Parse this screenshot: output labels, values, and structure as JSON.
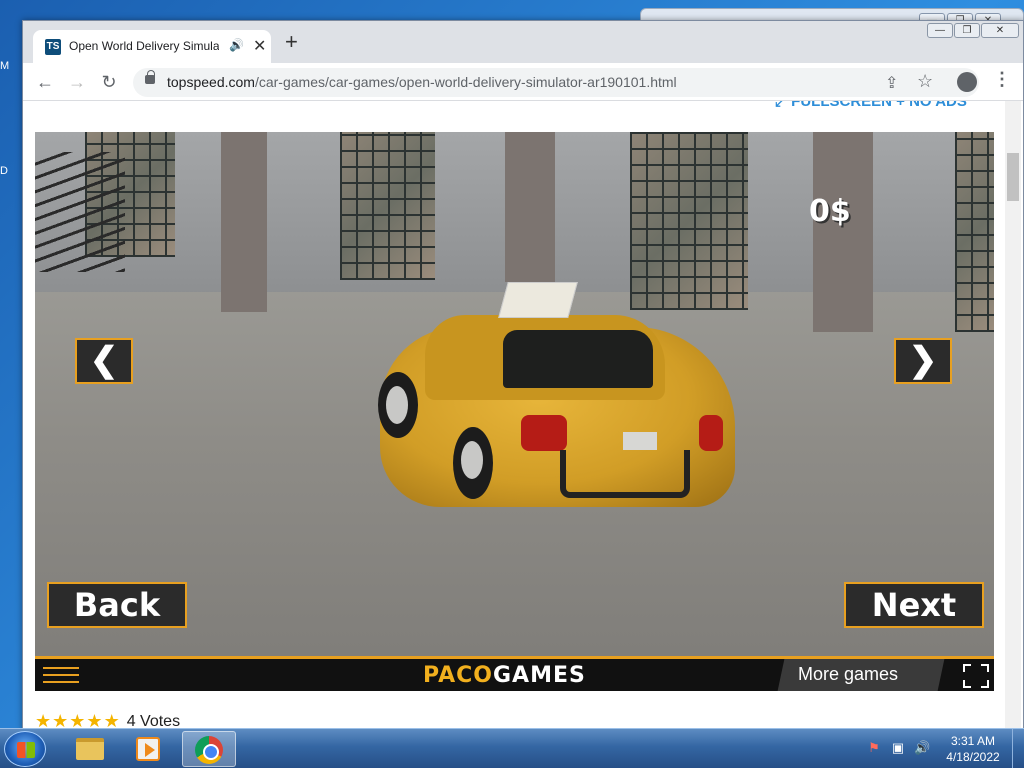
{
  "desktop": {
    "fragments": [
      "M",
      "D"
    ]
  },
  "browser": {
    "tab": {
      "favicon_text": "TS",
      "title": "Open World Delivery Simulator",
      "audio_icon": "speaker-icon",
      "close": "✕"
    },
    "new_tab": "+",
    "window_controls": {
      "minimize": "—",
      "maximize": "❐",
      "close": "✕"
    },
    "nav": {
      "back": "←",
      "forward": "→",
      "reload": "↻"
    },
    "url": {
      "host": "topspeed.com",
      "path": "/car-games/car-games/open-world-delivery-simulator-ar190101.html"
    },
    "omnibox_icons": {
      "share": "⇪",
      "star": "☆"
    },
    "menu": "⋮"
  },
  "page": {
    "fullscreen_link": "FULLSCREEN + NO ADS",
    "rating": {
      "stars": 5,
      "votes": "4 Votes"
    }
  },
  "game": {
    "money": "0$",
    "left_arrow": "❮",
    "right_arrow": "❯",
    "back_button": "Back",
    "next_button": "Next",
    "logo_part1": "PACO",
    "logo_part2": "GAMES",
    "more_games": "More games",
    "accent_color": "#e8a020"
  },
  "taskbar": {
    "apps": [
      "windows-explorer",
      "windows-media-player",
      "google-chrome"
    ],
    "active_app": "google-chrome",
    "tray": [
      "network-warning-icon",
      "network-icon",
      "volume-icon"
    ],
    "time": "3:31 AM",
    "date": "4/18/2022"
  }
}
